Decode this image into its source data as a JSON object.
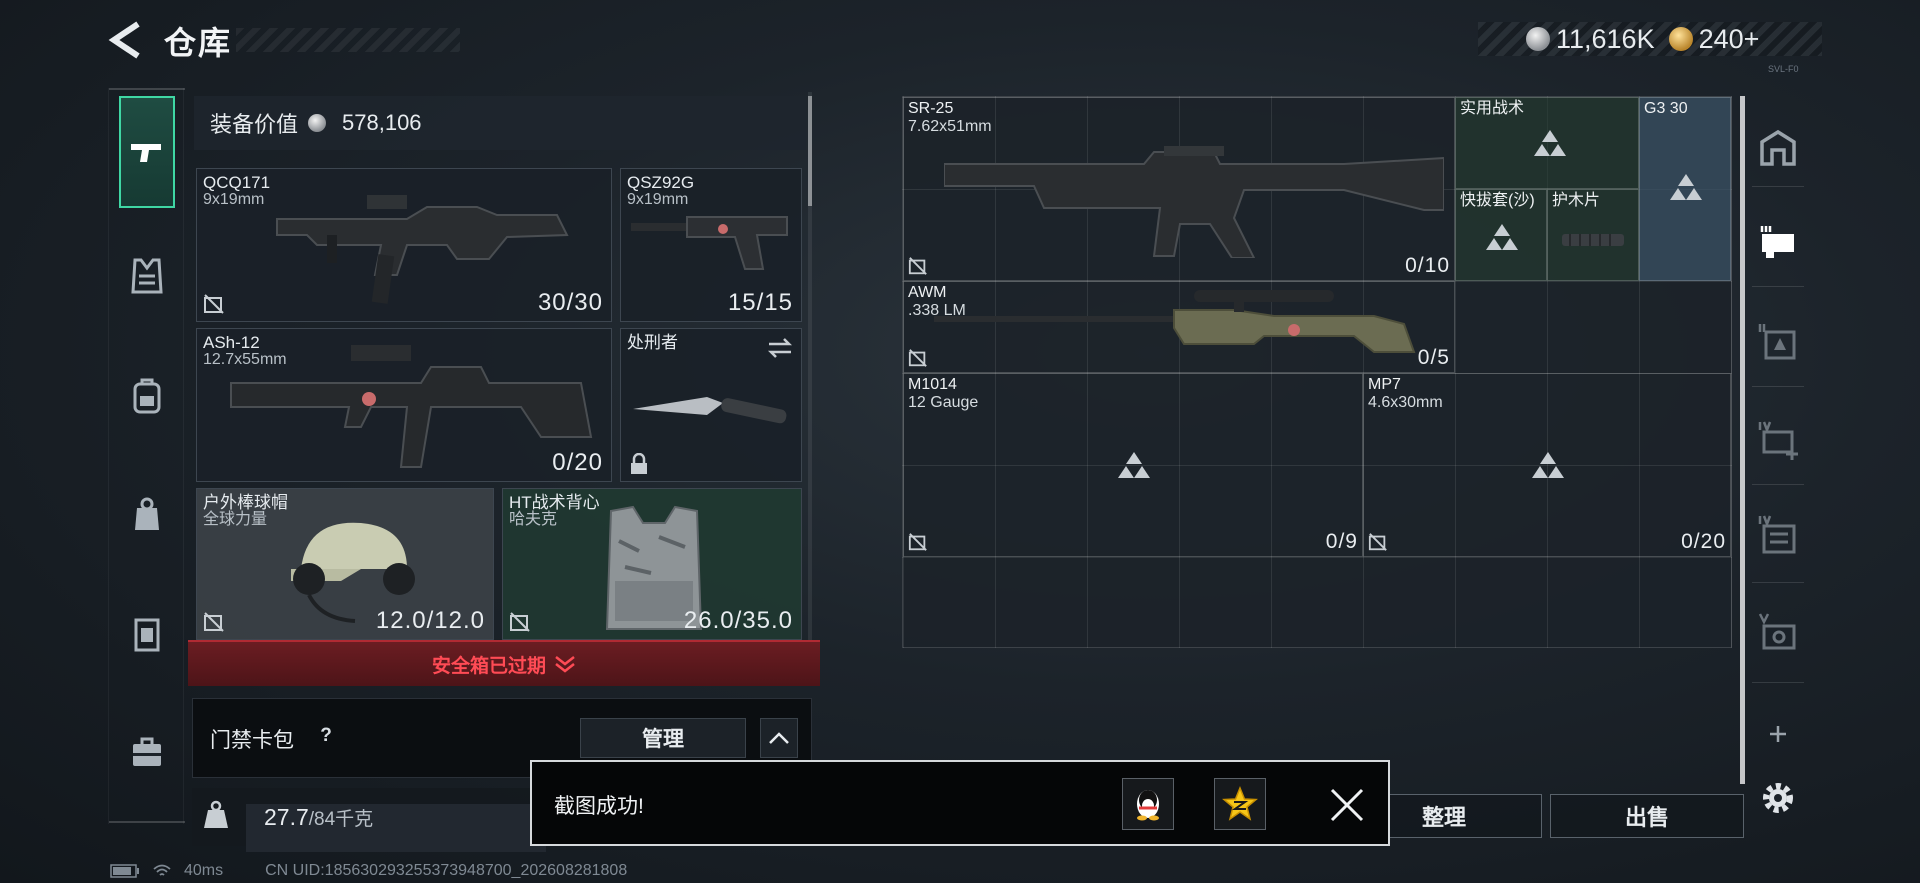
{
  "header": {
    "title": "仓库",
    "silver_amount": "11,616K",
    "gold_amount": "240+",
    "version": "SVL-F0"
  },
  "loadout": {
    "equipment_value_label": "装备价值",
    "equipment_value": "578,106",
    "slots": {
      "primary": {
        "name": "QCQ171",
        "ammo": "9x19mm",
        "count": "30/30"
      },
      "pistol": {
        "name": "QSZ92G",
        "ammo": "9x19mm",
        "count": "15/15"
      },
      "secondary": {
        "name": "ASh-12",
        "ammo": "12.7x55mm",
        "count": "0/20"
      },
      "melee": {
        "name": "处刑者"
      },
      "helmet": {
        "name": "户外棒球帽",
        "sub": "全球力量",
        "count": "12.0/12.0"
      },
      "armor": {
        "name": "HT战术背心",
        "sub": "哈夫克",
        "count": "26.0/35.0"
      }
    },
    "safebox_text": "安全箱已过期",
    "keycard_label": "门禁卡包",
    "keycard_help": "?",
    "manage_label": "管理",
    "weight_current": "27.7",
    "weight_max": "/84千克"
  },
  "storage": {
    "items": {
      "sr25": {
        "name": "SR-25",
        "ammo": "7.62x51mm",
        "count": "0/10"
      },
      "tactical": {
        "name": "实用战术"
      },
      "g3": {
        "name": "G3 30"
      },
      "holster": {
        "name": "快拔套(沙)"
      },
      "handguard": {
        "name": "护木片"
      },
      "awm": {
        "name": "AWM",
        "ammo": ".338 LM",
        "count": "0/5"
      },
      "m1014": {
        "name": "M1014",
        "ammo": "12 Gauge",
        "count": "0/9"
      },
      "mp7": {
        "name": "MP7",
        "ammo": "4.6x30mm",
        "count": "0/20"
      }
    },
    "sort_label": "整理",
    "sell_label": "出售"
  },
  "toast": {
    "message": "截图成功!"
  },
  "status": {
    "ping": "40ms",
    "uid": "CN UID:18563029325537394870​0_202608281808"
  },
  "colors": {
    "accent_green": "#3fd7a4",
    "alert_red": "#ff4b55"
  }
}
